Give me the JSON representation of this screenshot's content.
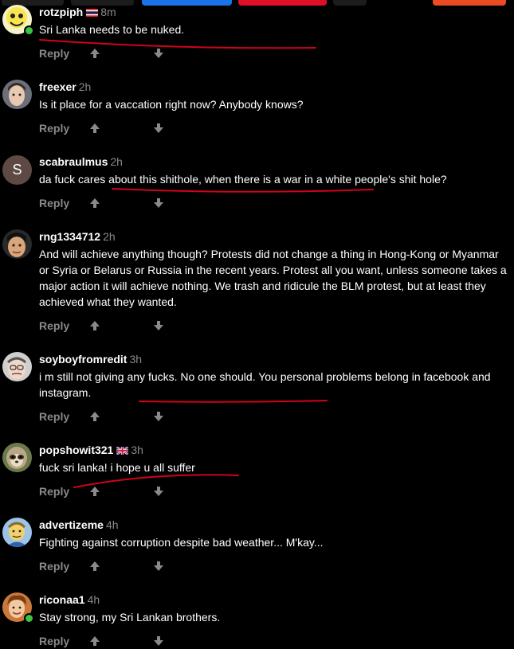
{
  "reply_label": "Reply",
  "comments": [
    {
      "username": "rotzpiph",
      "time": "8m",
      "text": "Sri Lanka needs to be nuked.",
      "flag": "thailand-flag-icon",
      "online": true
    },
    {
      "username": "freexer",
      "time": "2h",
      "text": "Is it place for a vaccation right now? Anybody knows?"
    },
    {
      "username": "scabraulmus",
      "time": "2h",
      "text": "da fuck cares about this shithole, when there is a war in a white people's shit hole?",
      "avatar_letter": "S"
    },
    {
      "username": "rng1334712",
      "time": "2h",
      "text": "And will achieve anything though? Protests did not change a thing in Hong-Kong or Myanmar or Syria or Belarus or Russia in the recent years. Protest all you want, unless someone takes a major action it will achieve nothing. We trash and ridicule the BLM protest, but at least they achieved what they wanted."
    },
    {
      "username": "soyboyfromredit",
      "time": "3h",
      "text": "i m still not giving any fucks. No one should. You personal problems belong in facebook and instagram."
    },
    {
      "username": "popshowit321",
      "time": "3h",
      "text": "fuck sri lanka! i hope u all suffer",
      "flag": "uk-flag-icon"
    },
    {
      "username": "advertizeme",
      "time": "4h",
      "text": "Fighting against corruption despite bad weather... M'kay..."
    },
    {
      "username": "riconaa1",
      "time": "4h",
      "text": "Stay strong, my Sri Lankan brothers.",
      "online": true
    }
  ],
  "colors": {
    "background": "#000000",
    "username": "#ffffff",
    "meta": "#8a8a8a",
    "annotation": "#d0021b",
    "online": "#39c443"
  }
}
